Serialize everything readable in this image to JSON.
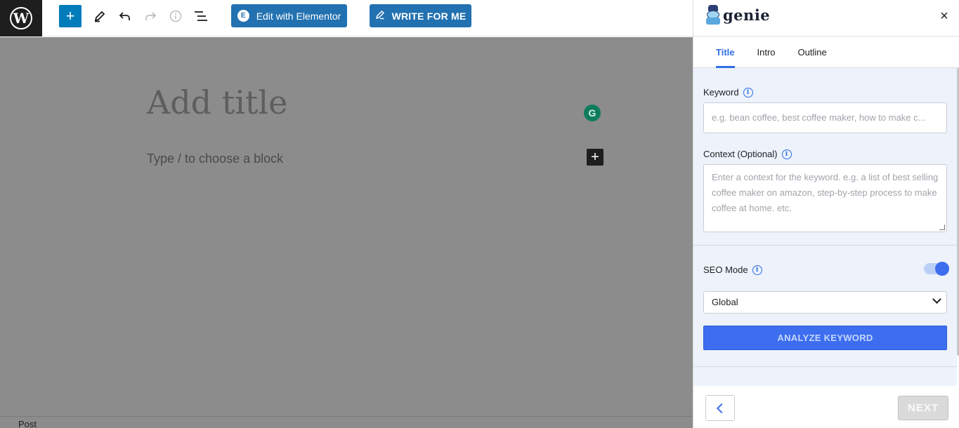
{
  "toolbar": {
    "add_block_symbol": "+",
    "elementor_label": "Edit with Elementor",
    "elementor_icon_letter": "E",
    "write_label": "WRITE FOR ME"
  },
  "editor": {
    "title_placeholder": "Add title",
    "block_placeholder": "Type / to choose a block",
    "grammarly_letter": "G",
    "inline_add_symbol": "+",
    "footer_breadcrumb": "Post"
  },
  "panel": {
    "brand": "genie",
    "close_symbol": "×",
    "tabs": [
      {
        "label": "Title",
        "active": true
      },
      {
        "label": "Intro",
        "active": false
      },
      {
        "label": "Outline",
        "active": false
      }
    ],
    "keyword": {
      "label": "Keyword",
      "placeholder": "e.g. bean coffee, best coffee maker, how to make c..."
    },
    "context": {
      "label": "Context (Optional)",
      "placeholder": "Enter a context for the keyword. e.g. a list of best selling coffee maker on amazon, step-by-step process to make coffee at home. etc."
    },
    "seo_mode": {
      "label": "SEO Mode",
      "enabled": true
    },
    "region_select": {
      "selected": "Global"
    },
    "analyze_label": "ANALYZE KEYWORD",
    "next_label": "NEXT"
  },
  "colors": {
    "wp_blue": "#007cba",
    "button_blue": "#2271b1",
    "accent_blue": "#3d6ef0",
    "panel_bg": "#edf2fb",
    "overlay_gray": "#8c8c8c"
  }
}
